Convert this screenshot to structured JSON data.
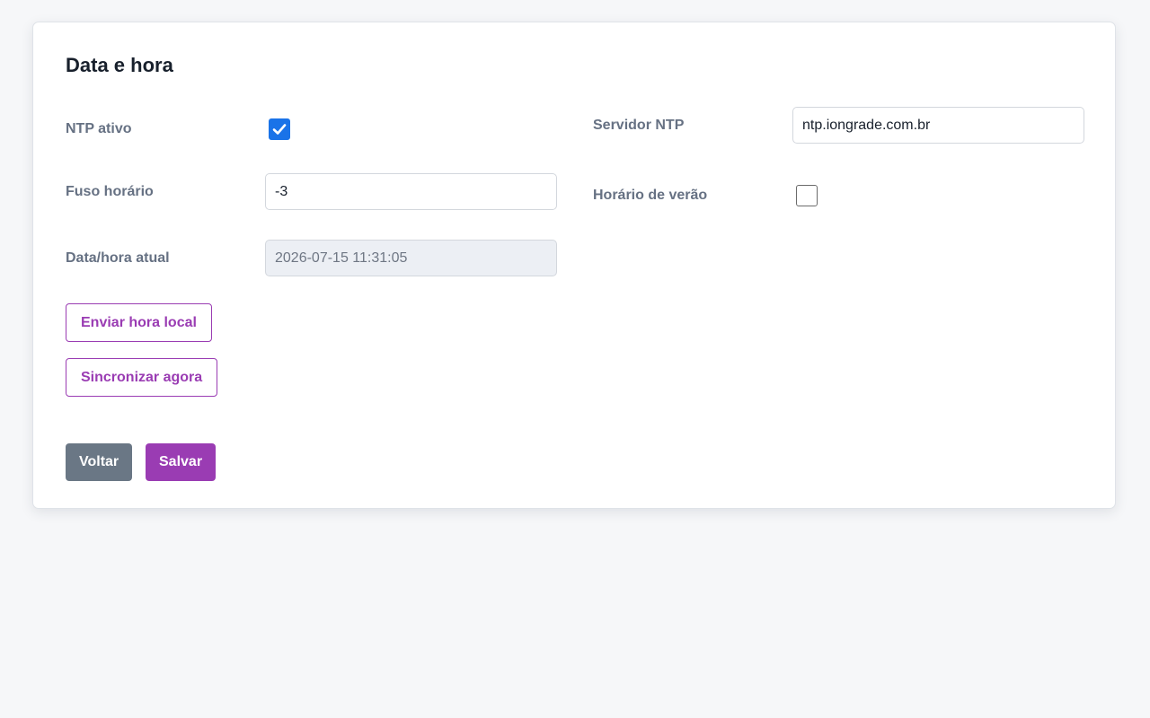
{
  "page": {
    "title": "Data e hora"
  },
  "form": {
    "ntp_active": {
      "label": "NTP ativo",
      "checked": true
    },
    "ntp_server": {
      "label": "Servidor NTP",
      "value": "ntp.iongrade.com.br"
    },
    "timezone": {
      "label": "Fuso horário",
      "value": "-3"
    },
    "daylight_saving": {
      "label": "Horário de verão",
      "checked": false
    },
    "current_datetime": {
      "label": "Data/hora atual",
      "value": "2026-07-15 11:31:05"
    }
  },
  "actions": {
    "send_local_time": "Enviar hora local",
    "sync_now": "Sincronizar agora",
    "back": "Voltar",
    "save": "Salvar"
  },
  "colors": {
    "accent": "#9a3cb3",
    "checkbox_checked": "#1a73e8",
    "secondary_button": "#6a7785",
    "label_text": "#667183",
    "title_text": "#18202c",
    "page_background": "#f6f7f9",
    "disabled_field": "#eceff4"
  },
  "icons": {
    "checkmark": "checkmark-icon"
  }
}
